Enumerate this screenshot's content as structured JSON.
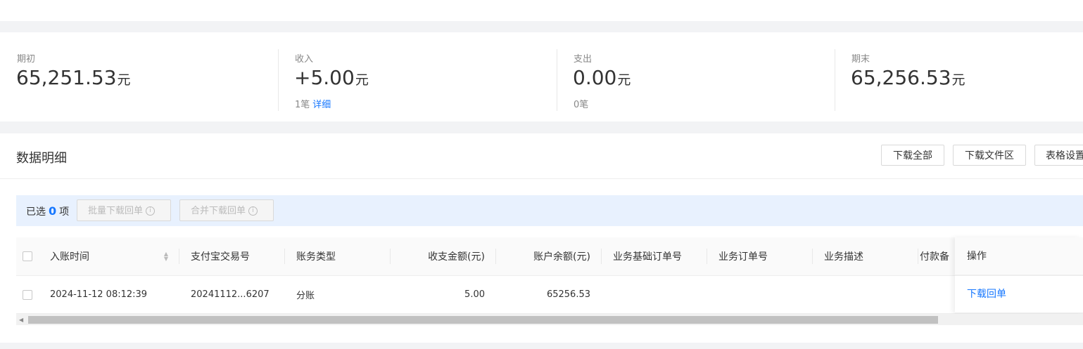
{
  "summary": {
    "opening": {
      "label": "期初",
      "amount": "65,251.53",
      "unit": "元"
    },
    "income": {
      "label": "收入",
      "amount": "+5.00",
      "unit": "元",
      "count": "1笔",
      "detail_link": "详细"
    },
    "expense": {
      "label": "支出",
      "amount": "0.00",
      "unit": "元",
      "count": "0笔"
    },
    "closing": {
      "label": "期末",
      "amount": "65,256.53",
      "unit": "元"
    }
  },
  "details": {
    "title": "数据明细",
    "buttons": {
      "download_all": "下载全部",
      "download_files": "下载文件区",
      "table_settings": "表格设置"
    },
    "selection": {
      "prefix": "已选",
      "count": "0",
      "suffix": "项",
      "batch_download": "批量下载回单",
      "merge_download": "合并下载回单"
    },
    "columns": [
      "入账时间",
      "支付宝交易号",
      "账务类型",
      "收支金额(元)",
      "账户余额(元)",
      "业务基础订单号",
      "业务订单号",
      "业务描述",
      "付款备",
      "操作"
    ],
    "rows": [
      {
        "time": "2024-11-12 08:12:39",
        "trade_no": "20241112...6207",
        "type": "分账",
        "amount": "5.00",
        "balance": "65256.53",
        "base_order": "",
        "order": "",
        "desc": "",
        "remark": "",
        "action": "下载回单"
      }
    ]
  },
  "colors": {
    "accent": "#1677ff",
    "selection_bg": "#e8f1fe",
    "page_bg": "#f2f3f5"
  }
}
